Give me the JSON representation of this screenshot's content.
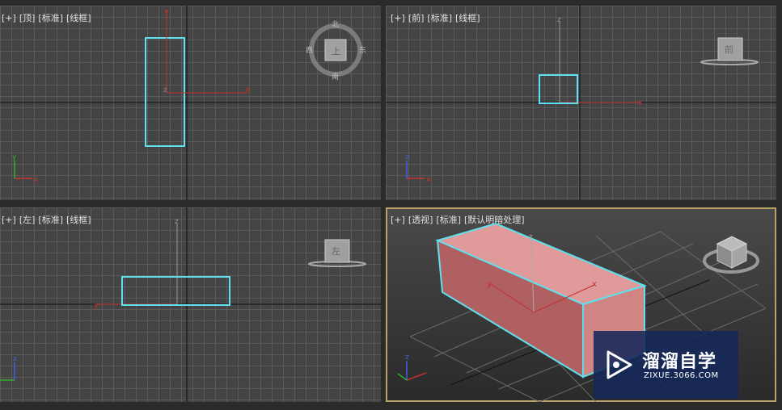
{
  "viewports": {
    "top": {
      "plus": "[+]",
      "view": "[顶]",
      "shading": "[标准]",
      "mode": "[线框]",
      "cube": {
        "center": "上",
        "north": "北",
        "south": "南",
        "east": "东",
        "west": "西"
      }
    },
    "front": {
      "plus": "[+]",
      "view": "[前]",
      "shading": "[标准]",
      "mode": "[线框]",
      "cube": {
        "face": "前"
      }
    },
    "left": {
      "plus": "[+]",
      "view": "[左]",
      "shading": "[标准]",
      "mode": "[线框]",
      "cube": {
        "face": "左"
      }
    },
    "perspective": {
      "plus": "[+]",
      "view": "[透视]",
      "shading": "[标准]",
      "mode": "[默认明暗处理]"
    }
  },
  "axes": {
    "x": "x",
    "y": "y",
    "z": "z"
  },
  "colors": {
    "selection": "#5fe0ee",
    "box": "#d98a8a",
    "active_border": "#b8a26a"
  },
  "watermark": {
    "title": "溜溜自学",
    "url": "ZIXUE.3066.COM"
  }
}
